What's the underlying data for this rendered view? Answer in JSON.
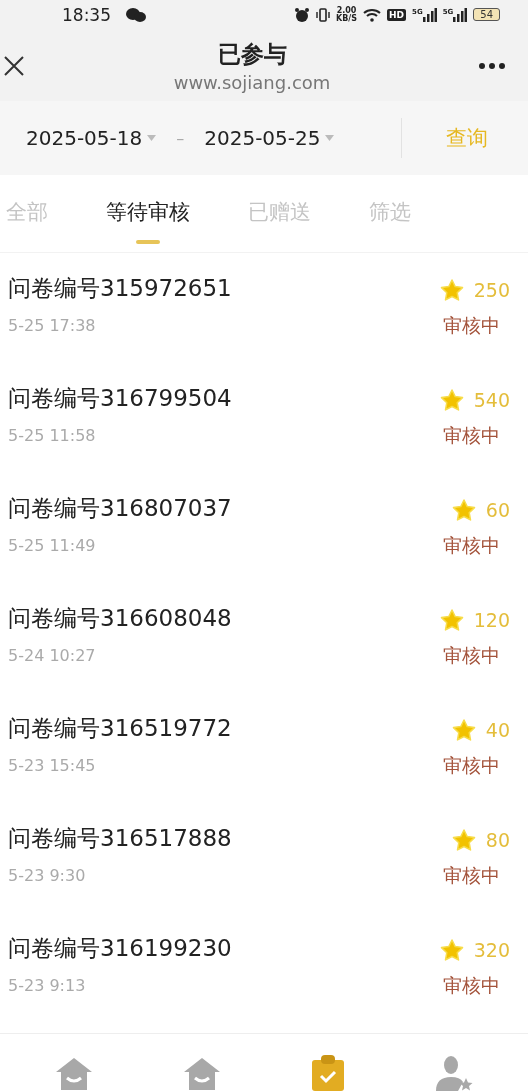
{
  "status_bar": {
    "time": "18:35",
    "speed": "2.00",
    "speed_unit": "KB/S",
    "hd": "HD",
    "signal_labels": [
      "5G",
      "5G"
    ],
    "battery": "54"
  },
  "header": {
    "title": "已参与",
    "subtitle": "www.sojiang.com"
  },
  "date_filter": {
    "start": "2025-05-18",
    "separator": "–",
    "end": "2025-05-25",
    "button": "查询"
  },
  "tabs": [
    {
      "label": "全部",
      "selected": false
    },
    {
      "label": "等待审核",
      "selected": true
    },
    {
      "label": "已赠送",
      "selected": false
    },
    {
      "label": "筛选",
      "selected": false
    }
  ],
  "surveys": [
    {
      "title": "问卷编号315972651",
      "time": "5-25 17:38",
      "points": "250",
      "status": "审核中"
    },
    {
      "title": "问卷编号316799504",
      "time": "5-25 11:58",
      "points": "540",
      "status": "审核中"
    },
    {
      "title": "问卷编号316807037",
      "time": "5-25 11:49",
      "points": "60",
      "status": "审核中"
    },
    {
      "title": "问卷编号316608048",
      "time": "5-24 10:27",
      "points": "120",
      "status": "审核中"
    },
    {
      "title": "问卷编号316519772",
      "time": "5-23 15:45",
      "points": "40",
      "status": "审核中"
    },
    {
      "title": "问卷编号316517888",
      "time": "5-23 9:30",
      "points": "80",
      "status": "审核中"
    },
    {
      "title": "问卷编号316199230",
      "time": "5-23 9:13",
      "points": "320",
      "status": "审核中"
    }
  ],
  "bottom_nav": [
    {
      "kind": "home",
      "selected": false
    },
    {
      "kind": "home",
      "selected": false
    },
    {
      "kind": "clipboard",
      "selected": true
    },
    {
      "kind": "user",
      "selected": false
    }
  ]
}
